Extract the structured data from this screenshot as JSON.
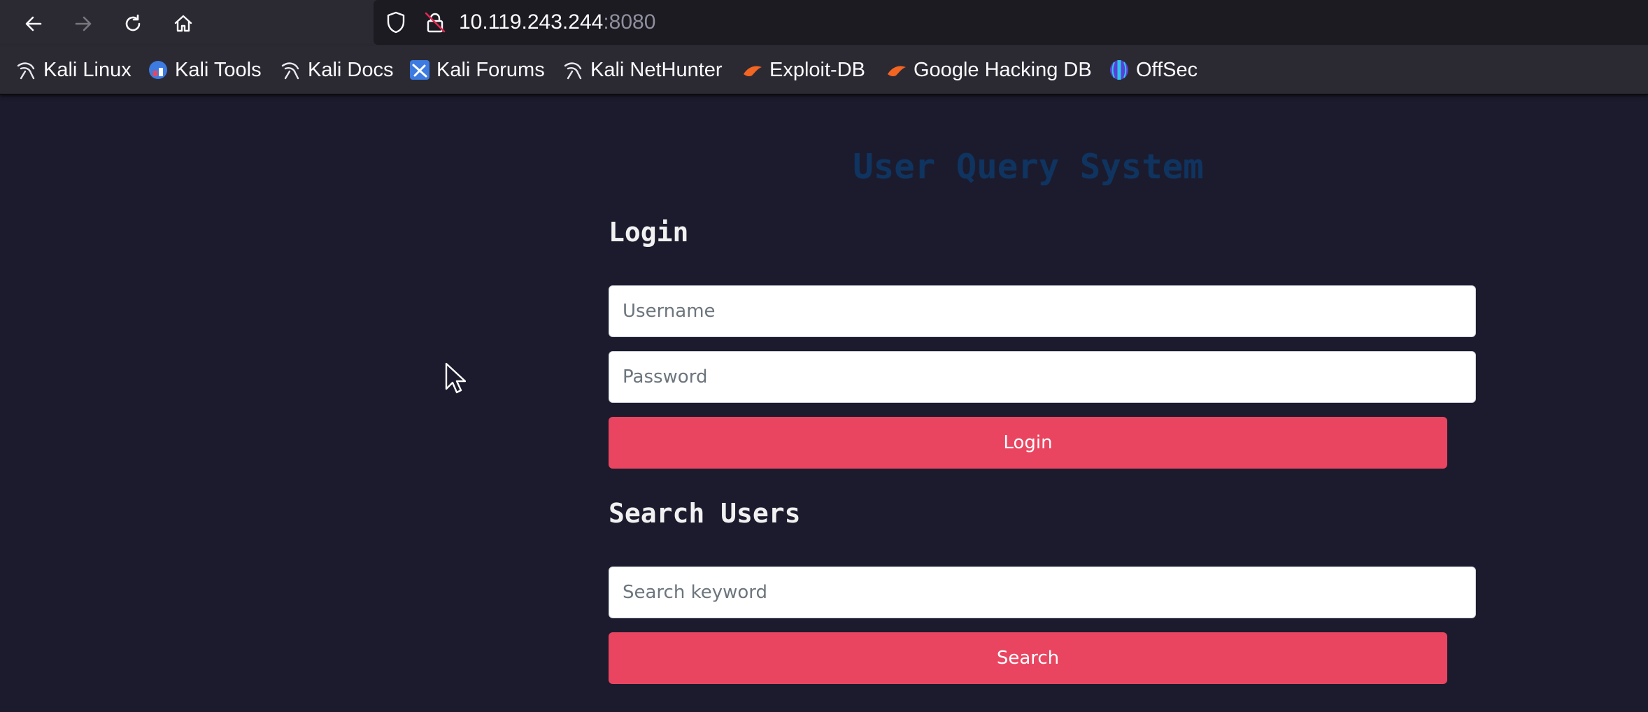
{
  "browser": {
    "url_host": "10.119.243.244",
    "url_port": ":8080",
    "bookmarks": [
      {
        "label": "Kali Linux",
        "icon": "kali-dragon-icon"
      },
      {
        "label": "Kali Tools",
        "icon": "kali-tools-icon"
      },
      {
        "label": "Kali Docs",
        "icon": "kali-dragon-icon"
      },
      {
        "label": "Kali Forums",
        "icon": "kali-forums-icon"
      },
      {
        "label": "Kali NetHunter",
        "icon": "kali-dragon-icon"
      },
      {
        "label": "Exploit-DB",
        "icon": "exploit-db-icon"
      },
      {
        "label": "Google Hacking DB",
        "icon": "exploit-db-icon"
      },
      {
        "label": "OffSec",
        "icon": "offsec-icon"
      }
    ]
  },
  "page": {
    "title": "User Query System",
    "login": {
      "heading": "Login",
      "username_placeholder": "Username",
      "password_placeholder": "Password",
      "button_label": "Login"
    },
    "search": {
      "heading": "Search Users",
      "keyword_placeholder": "Search keyword",
      "button_label": "Search"
    }
  },
  "colors": {
    "page_background": "#1c1b2e",
    "title": "#0f3460",
    "button": "#e94560"
  }
}
